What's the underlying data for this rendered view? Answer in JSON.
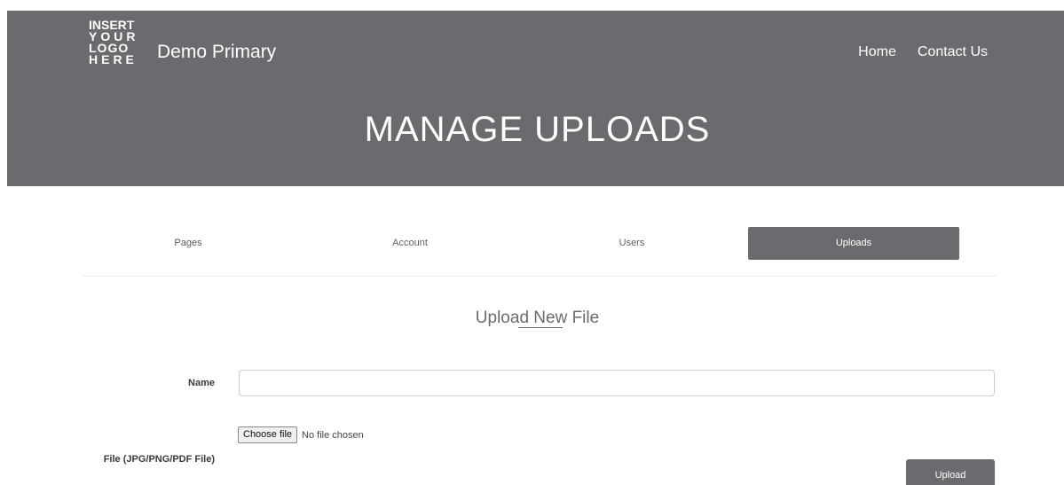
{
  "header": {
    "logo_lines": [
      "INSERT",
      "YOUR",
      "LOGO",
      "HERE"
    ],
    "brand": "Demo Primary",
    "nav": [
      {
        "label": "Home"
      },
      {
        "label": "Contact Us"
      }
    ],
    "title": "MANAGE UPLOADS"
  },
  "tabs": [
    {
      "label": "Pages",
      "active": false
    },
    {
      "label": "Account",
      "active": false
    },
    {
      "label": "Users",
      "active": false
    },
    {
      "label": "Uploads",
      "active": true
    }
  ],
  "form": {
    "title": "Upload New File",
    "name_label": "Name",
    "name_value": "",
    "name_placeholder": "",
    "file_label": "File (JPG/PNG/PDF File)",
    "choose_file_label": "Choose file",
    "file_status": "No file chosen",
    "submit_label": "Upload"
  },
  "colors": {
    "header_background": "#6b6a6f",
    "active_tab": "#6b6a6f",
    "button": "#6b6a6f"
  }
}
